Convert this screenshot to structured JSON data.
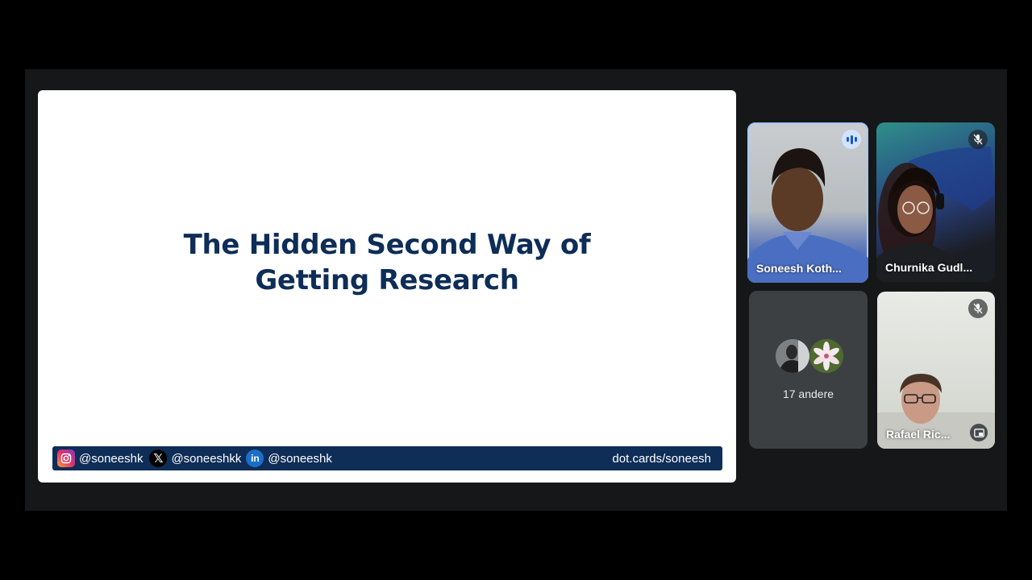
{
  "slide": {
    "title_line1": "The Hidden Second Way of",
    "title_line2": "Getting Research",
    "footer": {
      "instagram_handle": "@soneeshk",
      "x_handle": "@soneeshkk",
      "linkedin_handle": "@soneeshk",
      "linkedin_icon_text": "in",
      "x_icon_text": "𝕏",
      "website": "dot.cards/soneesh"
    }
  },
  "participants": [
    {
      "name": "Soneesh Koth...",
      "state": "speaking"
    },
    {
      "name": "Churnika Gudl...",
      "state": "muted"
    },
    {
      "name": "17 andere",
      "state": "group"
    },
    {
      "name": "Rafael Ric...",
      "state": "muted"
    }
  ],
  "icons": {
    "speaking": "audio-level-icon",
    "muted": "mic-off-icon",
    "pip": "picture-in-picture-icon",
    "instagram": "instagram-icon",
    "x": "x-logo-icon",
    "linkedin": "linkedin-icon"
  },
  "colors": {
    "slide_title": "#0e2d57",
    "footer_bar": "#0e2d57",
    "speaking_outline": "#a8c7fa",
    "stage_bg": "#151718"
  }
}
